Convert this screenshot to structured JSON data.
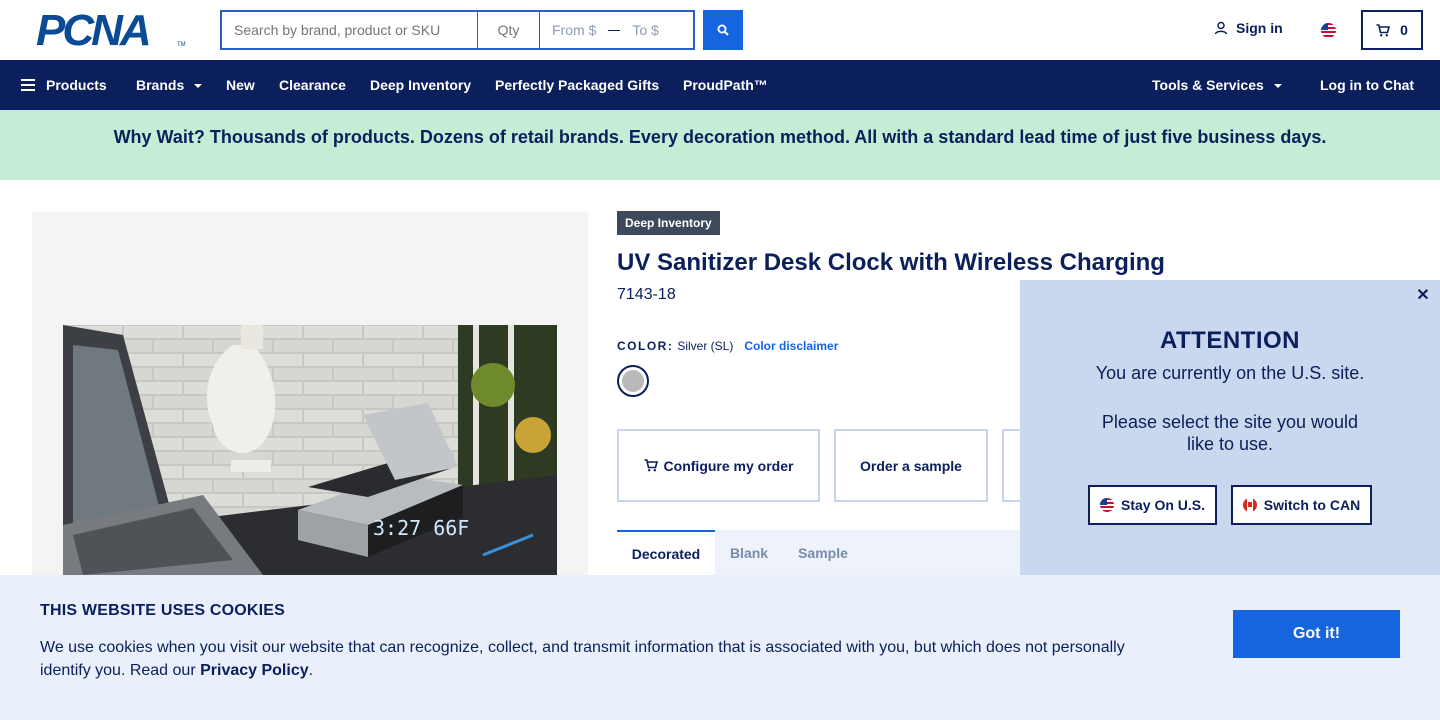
{
  "header": {
    "logo_text": "PCNA",
    "logo_tm": "TM",
    "search_placeholder": "Search by brand, product or SKU",
    "qty_placeholder": "Qty",
    "price_from_placeholder": "From $",
    "price_to_placeholder": "To $",
    "sign_in_label": "Sign in",
    "cart_count": "0"
  },
  "nav": {
    "items": [
      {
        "label": "Products"
      },
      {
        "label": "Brands"
      },
      {
        "label": "New"
      },
      {
        "label": "Clearance"
      },
      {
        "label": "Deep Inventory"
      },
      {
        "label": "Perfectly Packaged Gifts"
      },
      {
        "label": "ProudPath™"
      }
    ],
    "tools_label": "Tools & Services",
    "chat_label": "Log in to Chat"
  },
  "promo": {
    "text": "Why Wait? Thousands of products. Dozens of retail brands. Every decoration method. All with a standard lead time of just five business days."
  },
  "product": {
    "badge": "Deep Inventory",
    "title": "UV Sanitizer Desk Clock with Wireless Charging",
    "sku": "7143-18",
    "color_label": "COLOR:",
    "color_value": "Silver (SL)",
    "color_disclaimer": "Color disclaimer",
    "clock_display": "3:27 66F",
    "actions": {
      "configure": "Configure my order",
      "sample": "Order a sample"
    },
    "tabs": [
      {
        "label": "Decorated"
      },
      {
        "label": "Blank"
      },
      {
        "label": "Sample"
      }
    ]
  },
  "attention": {
    "title": "ATTENTION",
    "line1": "You are currently on the U.S. site.",
    "line2": "Please select the site you would like to use.",
    "stay_label": "Stay On U.S.",
    "switch_label": "Switch to CAN"
  },
  "cookie": {
    "title": "THIS WEBSITE USES COOKIES",
    "text": "We use cookies when you visit our website that can recognize, collect, and transmit information that is associated with you, but which does not personally identify you. Read our ",
    "link": "Privacy Policy",
    "text_end": ".",
    "button": "Got it!"
  },
  "colors": {
    "navy": "#0a1f5c",
    "accent_blue": "#1565e0",
    "promo_green": "#c5edd6",
    "popup_bg": "#c9d8ee",
    "cookie_bg": "#e9f0fb"
  }
}
